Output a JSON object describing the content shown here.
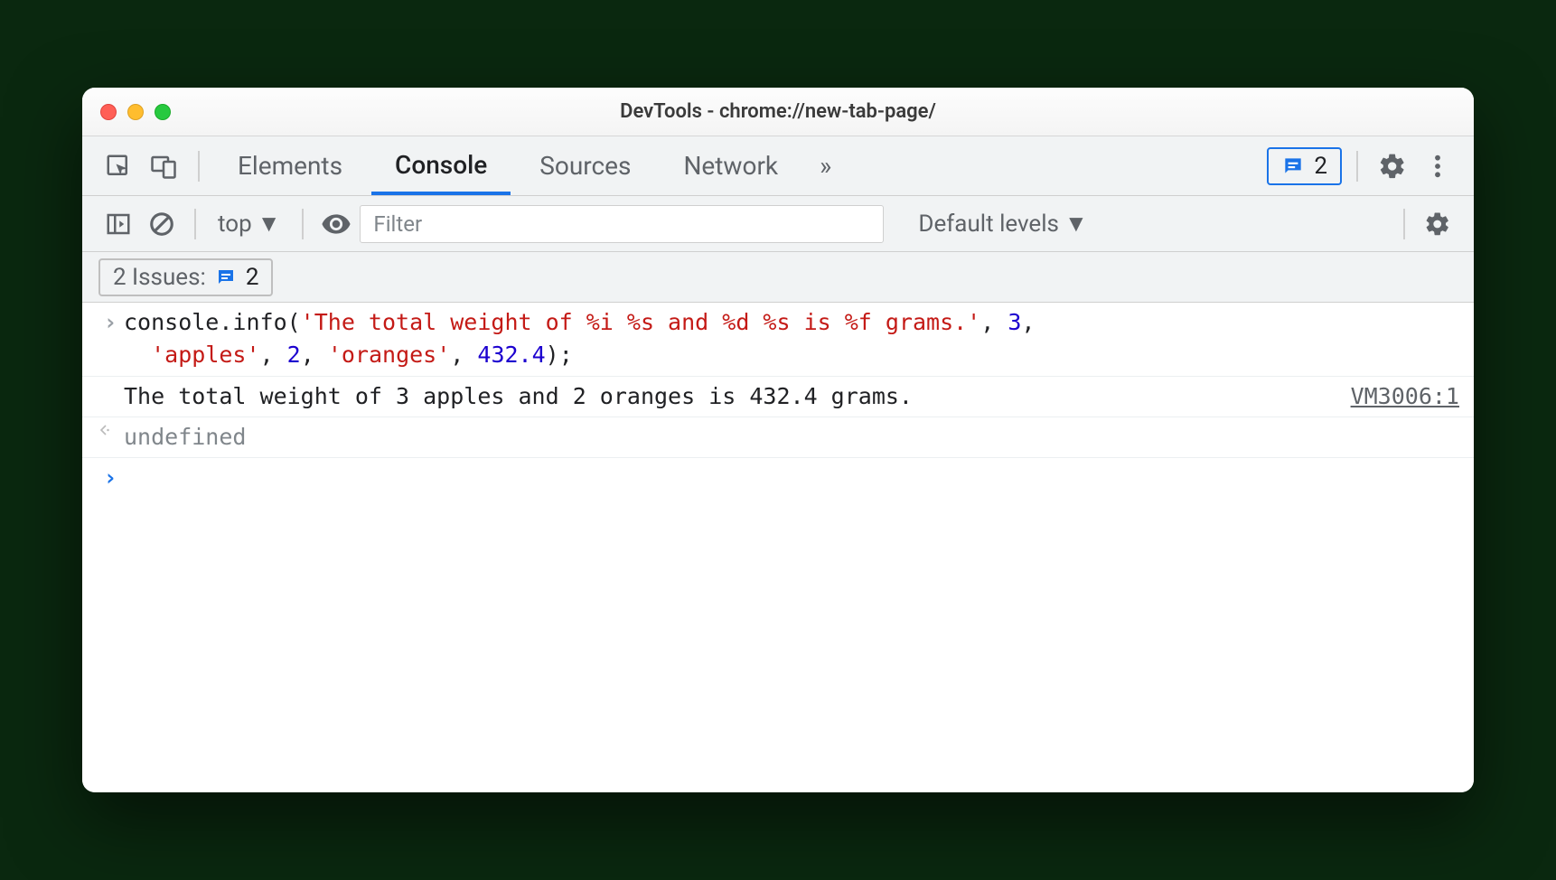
{
  "window": {
    "title": "DevTools - chrome://new-tab-page/"
  },
  "tabs": {
    "items": [
      "Elements",
      "Console",
      "Sources",
      "Network"
    ],
    "active": "Console",
    "overflow": "»"
  },
  "header_issues": {
    "count": "2"
  },
  "toolbar": {
    "context": "top",
    "filter_placeholder": "Filter",
    "levels": "Default levels"
  },
  "issues_bar": {
    "label": "2 Issues:",
    "count": "2"
  },
  "console": {
    "input": {
      "prefix": "console.info(",
      "str1": "'The total weight of %i %s and %d %s is %f grams.'",
      "sep1": ", ",
      "num1": "3",
      "sep2": ",\n  ",
      "str2": "'apples'",
      "sep3": ", ",
      "num2": "2",
      "sep4": ", ",
      "str3": "'oranges'",
      "sep5": ", ",
      "num3": "432.4",
      "suffix": ");"
    },
    "output": {
      "text": "The total weight of 3 apples and 2 oranges is 432.4 grams.",
      "source": "VM3006:1"
    },
    "return": "undefined"
  }
}
